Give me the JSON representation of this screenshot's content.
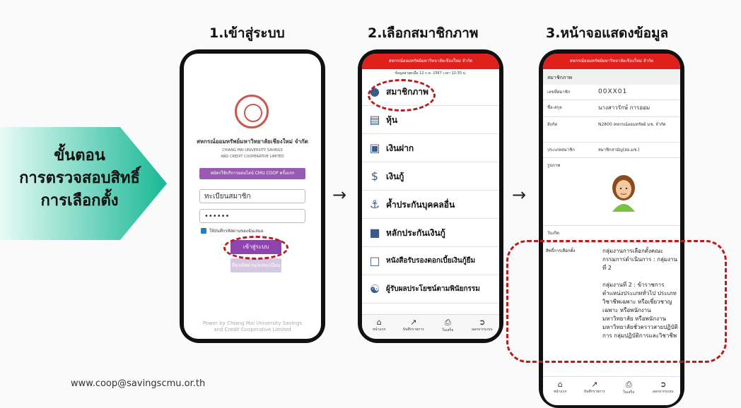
{
  "side_heading": [
    "ขั้นตอน",
    "การตรวจสอบสิทธิ์",
    "การเลือกตั้ง"
  ],
  "steps": [
    "1.เข้าสู่ระบบ",
    "2.เลือกสมาชิกภาพ",
    "3.หน้าจอแสดงข้อมูล"
  ],
  "arrow": "→",
  "footer_url": "www.coop@savingscmu.or.th",
  "phone1": {
    "org_name_th": "สหกรณ์ออมทรัพย์มหาวิทยาลัยเชียงใหม่ จำกัด",
    "org_name_en_1": "CHIANG MAI UNIVERSITY SAVINGS",
    "org_name_en_2": "AND CREDIT COOPERATIVE LIMITED",
    "register_button": "สมัครใช้บริการออนไลน์ CMU COOP ครั้งแรก",
    "member_placeholder": "ทะเบียนสมาชิก",
    "password_value": "••••••",
    "remember_label": "ให้บันทึกรหัสผ่านของฉันเสมอ",
    "login_button": "เข้าสู่ระบบ",
    "forgot_button": "ลืมรหัสผ่าน/ลงทะเบียนใหม่",
    "powered_1": "Power by Chiang Mai University Savings",
    "powered_2": "and Credit Cooperative Limited"
  },
  "phone2": {
    "header": "สหกรณ์ออมทรัพย์มหาวิทยาลัยเชียงใหม่ จำกัด",
    "date_line": "ข้อมูลล่าสุดเมื่อ 12 ก.ค. 2567 เวลา 12:30 น.",
    "menu": [
      {
        "icon": "member-icon",
        "label": "สมาชิกภาพ"
      },
      {
        "icon": "shares-icon",
        "label": "หุ้น"
      },
      {
        "icon": "deposit-icon",
        "label": "เงินฝาก"
      },
      {
        "icon": "loan-icon",
        "label": "เงินกู้"
      },
      {
        "icon": "guarantor-icon",
        "label": "ค้ำประกันบุคคลอื่น"
      },
      {
        "icon": "collateral-icon",
        "label": "หลักประกันเงินกู้"
      },
      {
        "icon": "pdf-icon",
        "label": "หนังสือรับรองดอกเบี้ยเงินกู้ยืม"
      },
      {
        "icon": "beneficiary-icon",
        "label": "ผู้รับผลประโยชน์ตามพินัยกรรม"
      }
    ],
    "tabs": [
      "หน้าแรก",
      "บันทึกรายการ",
      "ใบเสร็จ",
      "ออกจากระบบ"
    ]
  },
  "phone3": {
    "header": "สหกรณ์ออมทรัพย์มหาวิทยาลัยเชียงใหม่ จำกัด",
    "section_title": "สมาชิกภาพ",
    "rows": [
      {
        "label": "เลขที่สมาชิก",
        "value": "00XX01"
      },
      {
        "label": "ชื่อ-สกุล",
        "value": "นางสาวรักษ์ การออม"
      },
      {
        "label": "สังกัด",
        "value": "N2800 สหกรณ์ออมทรัพย์ มช. จำกัด"
      },
      {
        "label": "ประเภทสมาชิก",
        "value": "สมาชิกสามัญ(สอ.มช.)"
      },
      {
        "label": "รูปภาพ",
        "value": ""
      },
      {
        "label": "วันเกิด",
        "value": ""
      }
    ],
    "election_label": "สิทธิ์การเลือกตั้ง",
    "election_text": "กลุ่มงานการเลือกตั้งคณะกรรมการดำเนินการ : กลุ่มงานที่ 2\n\nกลุ่มงานที่ 2 : ข้าราชการตำแหน่งประเภททั่วไป ประเภทวิชาชีพเฉพาะ หรือเชี่ยวชาญเฉพาะ หรือพนักงานมหาวิทยาลัย หรือพนักงานมหาวิทยาลัยชั่วคราวสายปฏิบัติการ กลุ่มปฏิบัติการและวิชาชีพ",
    "tabs": [
      "หน้าแรก",
      "บันทึกรายการ",
      "ใบเสร็จ",
      "ออกจากระบบ"
    ]
  },
  "colors": {
    "accent_red": "#e0201b",
    "dash_red": "#b91c1c",
    "purple": "#8e44ad",
    "teal_start": "#c8f0e6",
    "teal_end": "#1abc9c"
  }
}
